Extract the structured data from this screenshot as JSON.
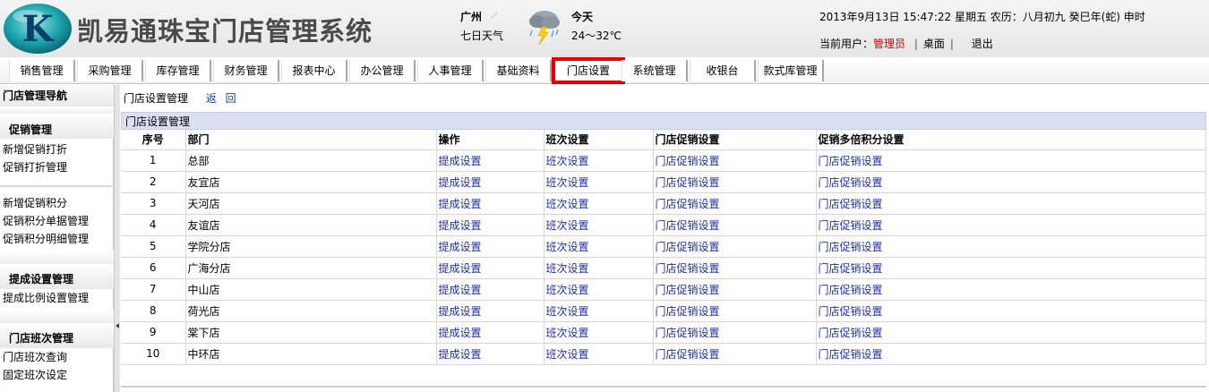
{
  "header": {
    "title": "凯易通珠宝门店管理系统",
    "logo_letter": "K",
    "city": "广州",
    "forecast_link": "七日天气",
    "today_label": "今天",
    "temperature": "24～32℃",
    "datetime": "2013年9月13日  15:47:22 星期五  农历：八月初九  癸巳年(蛇) 申时",
    "user_label": "当前用户：",
    "user_name": "管理员",
    "desktop_link": "桌面",
    "logout_link": "退出"
  },
  "nav": {
    "tabs": [
      {
        "label": "销售管理"
      },
      {
        "label": "采购管理"
      },
      {
        "label": "库存管理"
      },
      {
        "label": "财务管理"
      },
      {
        "label": "报表中心"
      },
      {
        "label": "办公管理"
      },
      {
        "label": "人事管理"
      },
      {
        "label": "基础资料"
      },
      {
        "label": "门店设置"
      },
      {
        "label": "系统管理"
      },
      {
        "label": "收银台"
      },
      {
        "label": "款式库管理"
      }
    ],
    "active_index": 8,
    "highlight_color": "#e60000"
  },
  "sidebar": {
    "heading": "门店管理导航",
    "groups": [
      {
        "title": "促销管理",
        "items": [
          "新增促销打折",
          "促销打折管理"
        ],
        "items2": [
          "新增促销积分",
          "促销积分单据管理",
          "促销积分明细管理"
        ]
      },
      {
        "title": "提成设置管理",
        "items": [
          "提成比例设置管理"
        ]
      },
      {
        "title": "门店班次管理",
        "items": [
          "门店班次查询",
          "固定班次设定"
        ]
      }
    ]
  },
  "main": {
    "breadcrumb": "门店设置管理",
    "back_label": "返 回",
    "panel_title": "门店设置管理",
    "columns": [
      "序号",
      "部门",
      "操作",
      "班次设置",
      "门店促销设置",
      "促销多倍积分设置"
    ],
    "rows": [
      {
        "no": "1",
        "dept": "总部",
        "op": "提成设置",
        "shift": "班次设置",
        "promo": "门店促销设置",
        "points": "门店促销设置"
      },
      {
        "no": "2",
        "dept": "友宜店",
        "op": "提成设置",
        "shift": "班次设置",
        "promo": "门店促销设置",
        "points": "门店促销设置"
      },
      {
        "no": "3",
        "dept": "天河店",
        "op": "提成设置",
        "shift": "班次设置",
        "promo": "门店促销设置",
        "points": "门店促销设置"
      },
      {
        "no": "4",
        "dept": "友谊店",
        "op": "提成设置",
        "shift": "班次设置",
        "promo": "门店促销设置",
        "points": "门店促销设置"
      },
      {
        "no": "5",
        "dept": "学院分店",
        "op": "提成设置",
        "shift": "班次设置",
        "promo": "门店促销设置",
        "points": "门店促销设置"
      },
      {
        "no": "6",
        "dept": "广海分店",
        "op": "提成设置",
        "shift": "班次设置",
        "promo": "门店促销设置",
        "points": "门店促销设置"
      },
      {
        "no": "7",
        "dept": "中山店",
        "op": "提成设置",
        "shift": "班次设置",
        "promo": "门店促销设置",
        "points": "门店促销设置"
      },
      {
        "no": "8",
        "dept": "荷光店",
        "op": "提成设置",
        "shift": "班次设置",
        "promo": "门店促销设置",
        "points": "门店促销设置"
      },
      {
        "no": "9",
        "dept": "棠下店",
        "op": "提成设置",
        "shift": "班次设置",
        "promo": "门店促销设置",
        "points": "门店促销设置"
      },
      {
        "no": "10",
        "dept": "中环店",
        "op": "提成设置",
        "shift": "班次设置",
        "promo": "门店促销设置",
        "points": "门店促销设置"
      }
    ]
  }
}
